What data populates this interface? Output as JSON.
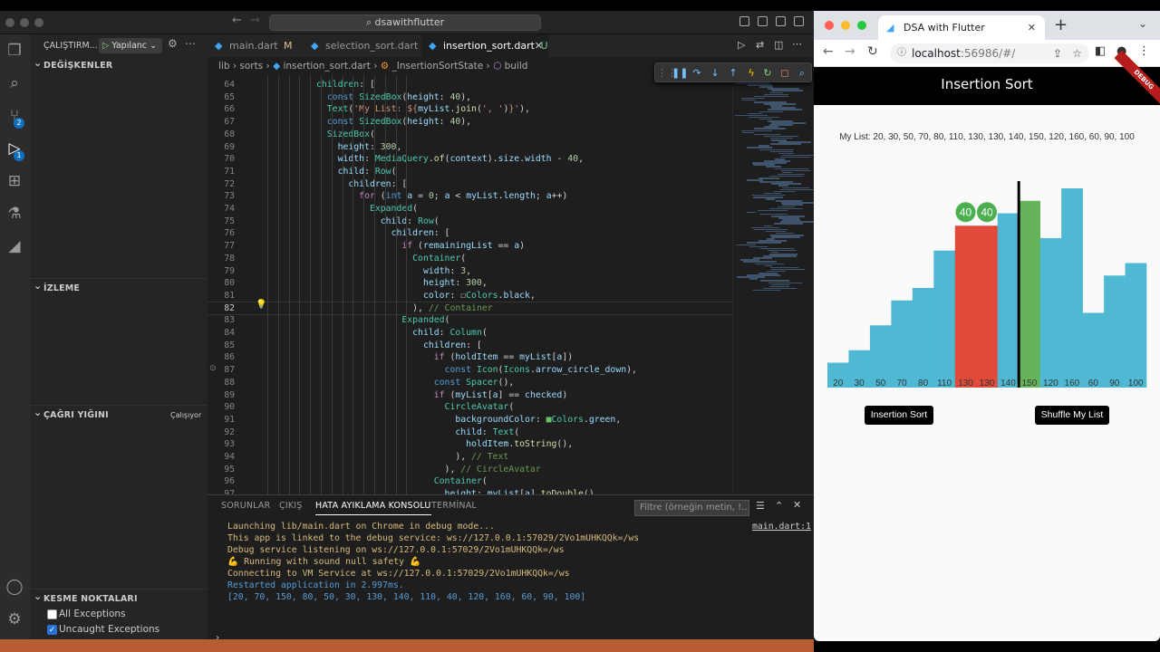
{
  "vscode": {
    "command_center": "dsawithflutter",
    "sidebar": {
      "run_label": "ÇALIŞTIRM...",
      "config_label": "Yapılanc",
      "variables_header": "DEĞİŞKENLER",
      "watch_header": "İZLEME",
      "callstack_header": "ÇAĞRI YIĞINI",
      "callstack_status": "Çalışıyor",
      "breakpoints_header": "KESME NOKTALARI",
      "breakpoints": [
        {
          "label": "All Exceptions",
          "checked": false
        },
        {
          "label": "Uncaught Exceptions",
          "checked": true
        }
      ]
    },
    "activity_badges": {
      "source_control": "2",
      "debug": "1"
    },
    "tabs": [
      {
        "label": "main.dart",
        "suffix": "M"
      },
      {
        "label": "selection_sort.dart",
        "suffix": ""
      },
      {
        "label": "insertion_sort.dart",
        "suffix": "U"
      }
    ],
    "breadcrumb": [
      "lib",
      "sorts",
      "insertion_sort.dart",
      "_InsertionSortState",
      "build"
    ],
    "code_lines": [
      {
        "n": "64",
        "html": "          <span class='cl'>children</span>: ["
      },
      {
        "n": "65",
        "html": "            <span class='kw'>const</span> <span class='cl'>SizedBox</span>(<span class='pr'>height</span>: <span class='nm'>40</span>),"
      },
      {
        "n": "66",
        "html": "            <span class='cl'>Text</span>(<span class='st'>'My List: ${</span><span class='pr'>myList</span>.<span class='fn'>join</span>(<span class='st'>', '</span>)<span class='st'>}'</span>),"
      },
      {
        "n": "67",
        "html": "            <span class='kw'>const</span> <span class='cl'>SizedBox</span>(<span class='pr'>height</span>: <span class='nm'>40</span>),"
      },
      {
        "n": "68",
        "html": "            <span class='cl'>SizedBox</span>("
      },
      {
        "n": "69",
        "html": "              <span class='pr'>height</span>: <span class='nm'>300</span>,"
      },
      {
        "n": "70",
        "html": "              <span class='pr'>width</span>: <span class='cl'>MediaQuery</span>.<span class='fn'>of</span>(<span class='pr'>context</span>).<span class='pr'>size</span>.<span class='pr'>width</span> - <span class='nm'>40</span>,"
      },
      {
        "n": "71",
        "html": "              <span class='pr'>child</span>: <span class='cl'>Row</span>("
      },
      {
        "n": "72",
        "html": "                <span class='pr'>children</span>: ["
      },
      {
        "n": "73",
        "html": "                  <span class='ctl'>for</span> (<span class='kw'>int</span> <span class='pr'>a</span> = <span class='nm'>0</span>; <span class='pr'>a</span> &lt; <span class='pr'>myList</span>.<span class='pr'>length</span>; <span class='pr'>a</span>++)"
      },
      {
        "n": "74",
        "html": "                    <span class='cl'>Expanded</span>("
      },
      {
        "n": "75",
        "html": "                      <span class='pr'>child</span>: <span class='cl'>Row</span>("
      },
      {
        "n": "76",
        "html": "                        <span class='pr'>children</span>: ["
      },
      {
        "n": "77",
        "html": "                          <span class='ctl'>if</span> (<span class='pr'>remainingList</span> == <span class='pr'>a</span>)"
      },
      {
        "n": "78",
        "html": "                            <span class='cl'>Container</span>("
      },
      {
        "n": "79",
        "html": "                              <span class='pr'>width</span>: <span class='nm'>3</span>,"
      },
      {
        "n": "80",
        "html": "                              <span class='pr'>height</span>: <span class='nm'>300</span>,"
      },
      {
        "n": "81",
        "html": "                              <span class='pr'>color</span>: ☐<span class='cl'>Colors</span>.<span class='pr'>black</span>,"
      },
      {
        "n": "82",
        "html": "                            ), <span class='cm'>// Container</span>"
      },
      {
        "n": "83",
        "html": "                          <span class='cl'>Expanded</span>("
      },
      {
        "n": "84",
        "html": "                            <span class='pr'>child</span>: <span class='cl'>Column</span>("
      },
      {
        "n": "85",
        "html": "                              <span class='pr'>children</span>: ["
      },
      {
        "n": "86",
        "html": "                                <span class='ctl'>if</span> (<span class='pr'>holdItem</span> == <span class='pr'>myList</span>[<span class='pr'>a</span>])"
      },
      {
        "n": "87",
        "html": "                                  <span class='kw'>const</span> <span class='cl'>Icon</span>(<span class='cl'>Icons</span>.<span class='pr'>arrow_circle_down</span>),"
      },
      {
        "n": "88",
        "html": "                                <span class='kw'>const</span> <span class='cl'>Spacer</span>(),"
      },
      {
        "n": "89",
        "html": "                                <span class='ctl'>if</span> (<span class='pr'>myList</span>[<span class='pr'>a</span>] == <span class='pr'>checked</span>)"
      },
      {
        "n": "90",
        "html": "                                  <span class='cl'>CircleAvatar</span>("
      },
      {
        "n": "91",
        "html": "                                    <span class='pr'>backgroundColor</span>: <span style='color:#6abf69'>■</span><span class='cl'>Colors</span>.<span class='pr'>green</span>,"
      },
      {
        "n": "92",
        "html": "                                    <span class='pr'>child</span>: <span class='cl'>Text</span>("
      },
      {
        "n": "93",
        "html": "                                      <span class='pr'>holdItem</span>.<span class='fn'>toString</span>(),"
      },
      {
        "n": "94",
        "html": "                                    ), <span class='cm'>// Text</span>"
      },
      {
        "n": "95",
        "html": "                                  ), <span class='cm'>// CircleAvatar</span>"
      },
      {
        "n": "96",
        "html": "                                <span class='cl'>Container</span>("
      },
      {
        "n": "97",
        "html": "                                  <span class='pr'>height</span>: <span class='pr'>myList</span>[<span class='pr'>a</span>].<span class='fn'>toDouble</span>()"
      }
    ],
    "panel": {
      "tabs": [
        "SORUNLAR",
        "ÇIKIŞ",
        "HATA AYIKLAMA KONSOLU",
        "TERMİNAL"
      ],
      "filter_placeholder": "Filtre (örneğin metin, !...",
      "source_link": "main.dart:1",
      "output": [
        {
          "text": "Launching lib/main.dart on Chrome in debug mode...",
          "color": "#d7ba7d"
        },
        {
          "text": "This app is linked to the debug service: ws://127.0.0.1:57029/2Vo1mUHKQQk=/ws",
          "color": "#d7ba7d"
        },
        {
          "text": "Debug service listening on ws://127.0.0.1:57029/2Vo1mUHKQQk=/ws",
          "color": "#d7ba7d"
        },
        {
          "text": "💪 Running with sound null safety 💪",
          "color": "#d7ba7d"
        },
        {
          "text": "Connecting to VM Service at ws://127.0.0.1:57029/2Vo1mUHKQQk=/ws",
          "color": "#d7ba7d"
        },
        {
          "text": "Restarted application in 2.997ms.",
          "color": "#569cd6"
        },
        {
          "text": "[20, 70, 150, 80, 50, 30, 130, 140, 110, 40, 120, 160, 60, 90, 100]",
          "color": "#569cd6"
        }
      ]
    }
  },
  "browser": {
    "tab_title": "DSA with Flutter",
    "url_host": "localhost",
    "url_rest": ":56986/#/",
    "app_title": "Insertion Sort",
    "debug_ribbon": "DEBUG",
    "my_list_text": "My List: 20, 30, 50, 70, 80, 110, 130, 130, 140, 150, 120, 160, 60, 90, 100",
    "buttons": {
      "sort": "Insertion Sort",
      "shuffle": "Shuffle My List"
    }
  },
  "chart_data": {
    "type": "bar",
    "categories": [
      "20",
      "30",
      "50",
      "70",
      "80",
      "110",
      "130",
      "130",
      "140",
      "150",
      "120",
      "160",
      "60",
      "90",
      "100"
    ],
    "values": [
      20,
      30,
      50,
      70,
      80,
      110,
      130,
      130,
      140,
      150,
      120,
      160,
      60,
      90,
      100
    ],
    "bar_colors": [
      "#4fb9d4",
      "#4fb9d4",
      "#4fb9d4",
      "#4fb9d4",
      "#4fb9d4",
      "#4fb9d4",
      "#e04a3b",
      "#e04a3b",
      "#4fb9d4",
      "#65b35a",
      "#4fb9d4",
      "#4fb9d4",
      "#4fb9d4",
      "#4fb9d4",
      "#4fb9d4"
    ],
    "avatars": [
      {
        "index": 6,
        "label": "40"
      },
      {
        "index": 7,
        "label": "40"
      }
    ],
    "avatar_color": "#4caf50",
    "divider_before_index": 9,
    "ylim": [
      0,
      300
    ]
  }
}
